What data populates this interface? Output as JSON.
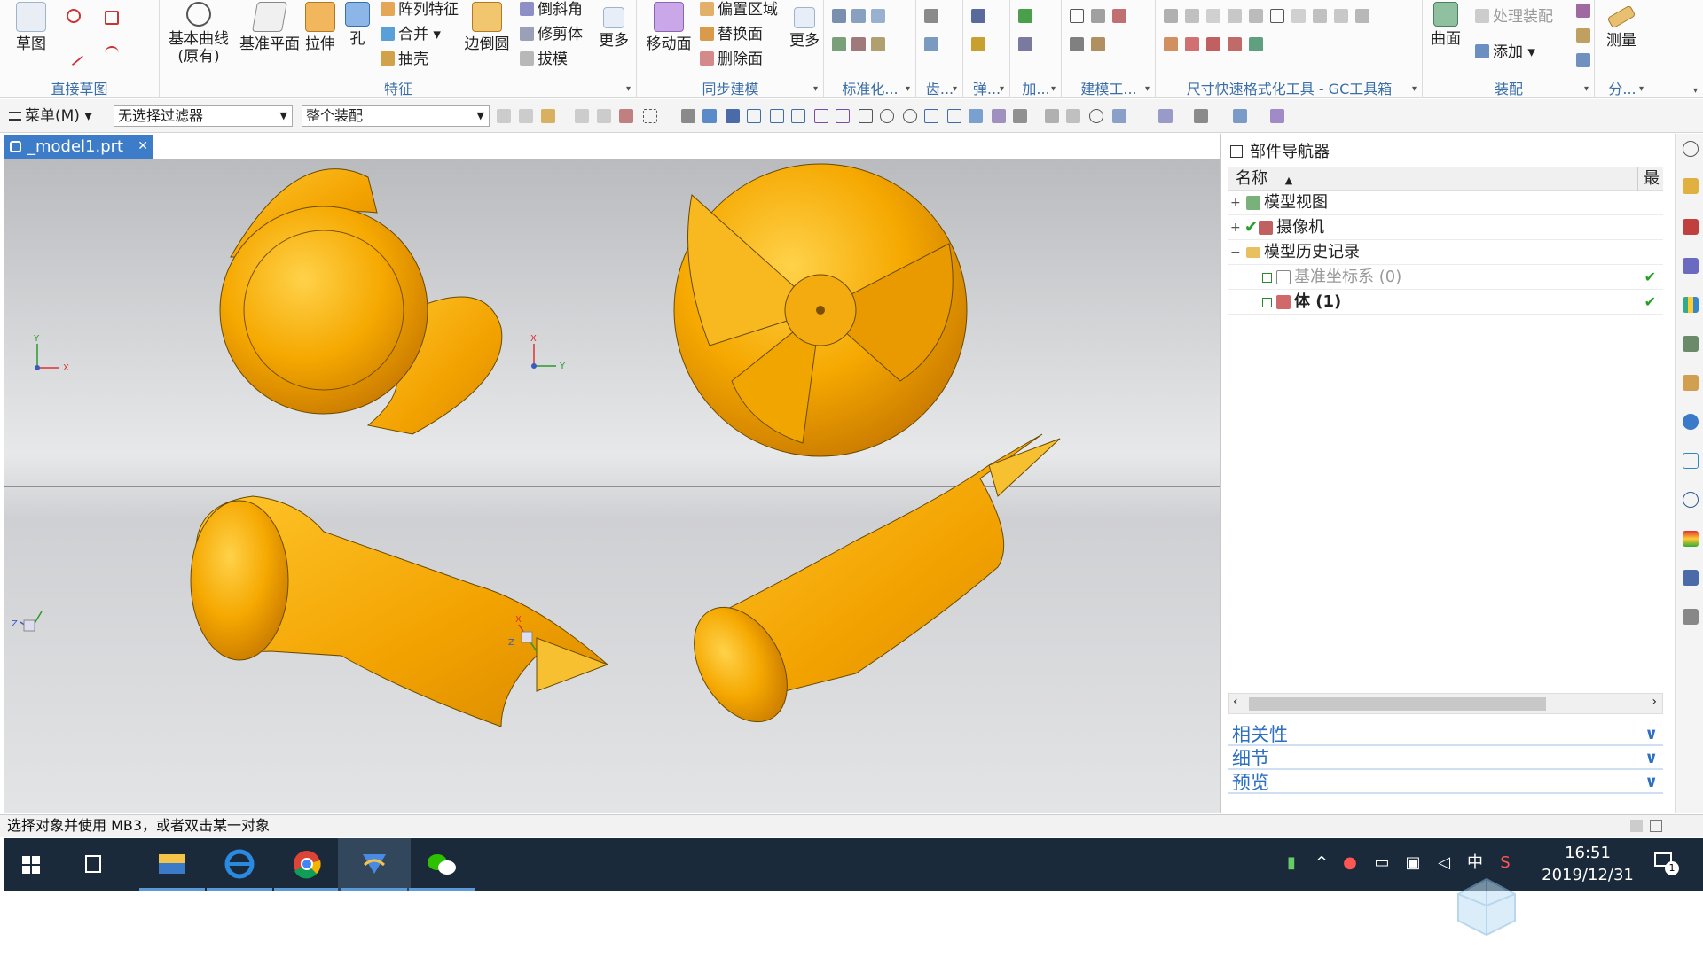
{
  "ribbon": {
    "groups": [
      {
        "title": "直接草图",
        "items": [
          "草图"
        ]
      },
      {
        "title": "特征",
        "items": [
          "基本曲线(原有)",
          "基准平面",
          "拉伸",
          "孔",
          "阵列特征",
          "合并",
          "抽壳",
          "边倒圆",
          "倒斜角",
          "修剪体",
          "拔模",
          "更多"
        ]
      },
      {
        "title": "同步建模",
        "items": [
          "移动面",
          "偏置区域",
          "替换面",
          "删除面",
          "更多"
        ]
      },
      {
        "title": "标准化...",
        "items": []
      },
      {
        "title": "齿...",
        "items": []
      },
      {
        "title": "弹...",
        "items": []
      },
      {
        "title": "加...",
        "items": []
      },
      {
        "title": "建模工...",
        "items": []
      },
      {
        "title": "尺寸快速格式化工具 - GC工具箱",
        "items": []
      },
      {
        "title": "装配",
        "items": [
          "曲面",
          "处理装配",
          "添加"
        ]
      },
      {
        "title": "分...",
        "items": [
          "测量"
        ]
      }
    ],
    "sketch_label": "草图",
    "basic_curve_label": "基本曲线",
    "basic_curve_sub": "(原有)",
    "datum_plane_label": "基准平面",
    "extrude_label": "拉伸",
    "hole_label": "孔",
    "pattern_label": "阵列特征",
    "unite_label": "合并",
    "shell_label": "抽壳",
    "edge_blend_label": "边倒圆",
    "chamfer_label": "倒斜角",
    "trim_body_label": "修剪体",
    "draft_label": "拔模",
    "more_label": "更多",
    "move_face_label": "移动面",
    "offset_region_label": "偏置区域",
    "replace_face_label": "替换面",
    "delete_face_label": "删除面",
    "more2_label": "更多",
    "surface_label": "曲面",
    "process_assembly_label": "处理装配",
    "add_label": "添加",
    "measure_label": "测量"
  },
  "toolbar": {
    "menu_label": "菜单(M)",
    "filter_value": "无选择过滤器",
    "assembly_scope_value": "整个装配"
  },
  "tab": {
    "label": "_model1.prt"
  },
  "navigator": {
    "title": "部件导航器",
    "column_name": "名称",
    "column_latest": "最",
    "rows": [
      {
        "label": "模型视图",
        "expander": "+"
      },
      {
        "label": "摄像机",
        "expander": "+"
      },
      {
        "label": "模型历史记录",
        "expander": "−"
      },
      {
        "label": "基准坐标系 (0)",
        "expander": ""
      },
      {
        "label": "体 (1)",
        "expander": ""
      }
    ],
    "sections": [
      "相关性",
      "细节",
      "预览"
    ]
  },
  "status": {
    "text": "选择对象并使用 MB3，或者双击某一对象"
  },
  "clock": {
    "time": "16:51",
    "date": "2019/12/31"
  },
  "tray": {
    "ime": "中",
    "notification_count": "1"
  },
  "colors": {
    "accent": "#3d7cc8",
    "model": "#f5a800",
    "taskbar": "#1b2a3a"
  }
}
